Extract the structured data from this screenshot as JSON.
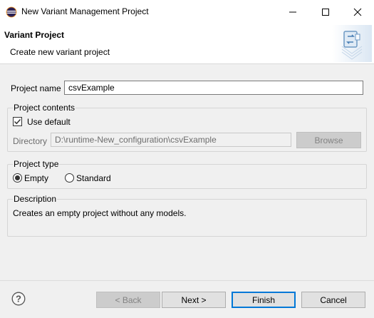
{
  "window": {
    "title": "New Variant Management Project",
    "controls": {
      "minimize": "minimize-icon",
      "maximize": "maximize-icon",
      "close": "close-icon"
    }
  },
  "header": {
    "title": "Variant Project",
    "subtitle": "Create new variant project"
  },
  "project_name": {
    "label": "Project name",
    "value": "csvExample"
  },
  "project_contents": {
    "label": "Project contents",
    "use_default": {
      "label": "Use default",
      "checked": true
    },
    "directory": {
      "label": "Directory",
      "value": "D:\\runtime-New_configuration\\csvExample",
      "enabled": false
    },
    "browse_label": "Browse"
  },
  "project_type": {
    "label": "Project type",
    "options": [
      {
        "label": "Empty",
        "selected": true
      },
      {
        "label": "Standard",
        "selected": false
      }
    ]
  },
  "description": {
    "label": "Description",
    "text": "Creates an empty project without any models."
  },
  "footer": {
    "back_label": "< Back",
    "next_label": "Next >",
    "finish_label": "Finish",
    "cancel_label": "Cancel"
  },
  "colors": {
    "accent": "#0078d7",
    "window_bg": "#f0f0f0",
    "header_bg": "#ffffff"
  }
}
